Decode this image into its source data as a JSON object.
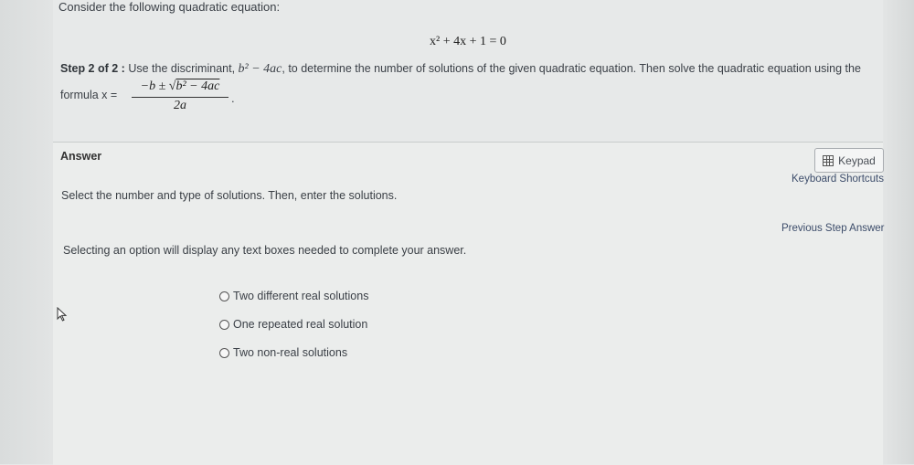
{
  "question": {
    "prompt": "Consider the following quadratic equation:",
    "equation": "x² + 4x + 1 = 0",
    "step_label": "Step 2 of 2 :",
    "step_text_1": "Use the discriminant,",
    "discriminant": "b² − 4ac",
    "step_text_2": ", to determine the number of solutions of the given quadratic equation. Then solve the quadratic equation using the",
    "formula_label": "formula x =",
    "formula_numerator_prefix": "−b ± √",
    "formula_numerator_radicand": "b² − 4ac",
    "formula_denominator": "2a",
    "formula_end": "."
  },
  "answer": {
    "label": "Answer",
    "keypad_label": "Keypad",
    "keyboard_shortcuts": "Keyboard Shortcuts",
    "previous_step": "Previous Step Answer",
    "instruction": "Select the number and type of solutions. Then, enter the solutions.",
    "note": "Selecting an option will display any text boxes needed to complete your answer.",
    "options": [
      "Two different real solutions",
      "One repeated real solution",
      "Two non-real solutions"
    ]
  },
  "icons": {
    "keypad": "keypad-icon",
    "cursor": "mouse-pointer-icon",
    "radio": "radio-button-icon"
  }
}
